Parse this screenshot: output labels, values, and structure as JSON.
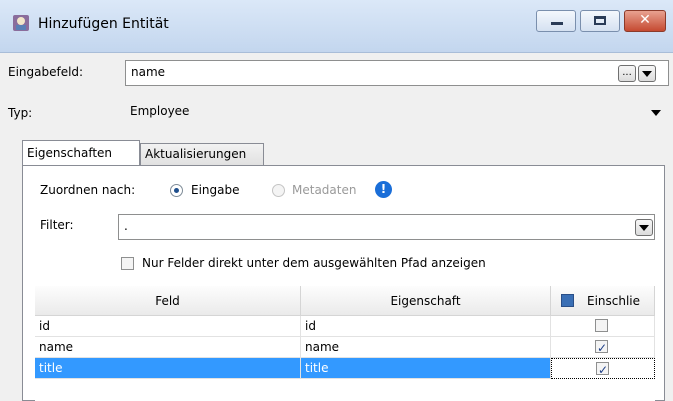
{
  "window": {
    "title": "Hinzufügen Entität",
    "minimize_icon": "minimize-icon",
    "maximize_icon": "maximize-icon",
    "close_icon": "close-icon",
    "close_glyph": "✕"
  },
  "input_field": {
    "label": "Eingabefeld:",
    "value": "name",
    "browse_label": "..."
  },
  "type_field": {
    "label": "Typ:",
    "value": "Employee"
  },
  "tabs": [
    {
      "label": "Eigenschaften",
      "active": true
    },
    {
      "label": "Aktualisierungen",
      "active": false
    }
  ],
  "mapping": {
    "label": "Zuordnen nach:",
    "options": [
      {
        "label": "Eingabe",
        "selected": true,
        "enabled": true
      },
      {
        "label": "Metadaten",
        "selected": false,
        "enabled": false
      }
    ],
    "info_glyph": "!"
  },
  "filter": {
    "label": "Filter:",
    "value": "."
  },
  "only_direct_fields": {
    "label": "Nur Felder direkt unter dem ausgewählten Pfad anzeigen",
    "checked": false
  },
  "table": {
    "columns": [
      "Feld",
      "Eigenschaft",
      "Einschlie"
    ],
    "rows": [
      {
        "feld": "id",
        "eigenschaft": "id",
        "include": false,
        "selected": false
      },
      {
        "feld": "name",
        "eigenschaft": "name",
        "include": true,
        "selected": false
      },
      {
        "feld": "title",
        "eigenschaft": "title",
        "include": true,
        "selected": true
      }
    ]
  },
  "colors": {
    "selection": "#3399ff",
    "close_button": "#c54a31",
    "info_icon": "#1a6ed8"
  }
}
